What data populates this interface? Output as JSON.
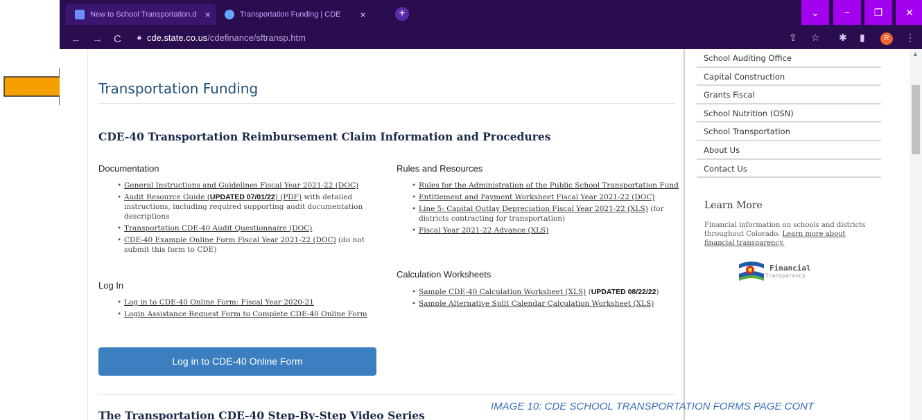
{
  "browser": {
    "tabs": [
      {
        "label": "New to School Transportation.d",
        "close": "×"
      },
      {
        "label": "Transportation Funding | CDE",
        "close": "×"
      }
    ],
    "new_tab": "+",
    "url_domain": "cde.state.co.us",
    "url_path": "/cdefinance/sftransp.htm",
    "profile_initial": "R",
    "window_controls": {
      "menu": "⌄",
      "minimize": "−",
      "maximize": "❐",
      "close": "✕"
    },
    "nav": {
      "back": "←",
      "forward": "→",
      "reload": "C"
    }
  },
  "page": {
    "title": "Transportation Funding",
    "section_heading": "CDE-40 Transportation Reimbursement Claim Information and Procedures",
    "documentation": {
      "heading": "Documentation",
      "items": [
        {
          "link": "General Instructions and Guidelines Fiscal Year 2021-22 (DOC)"
        },
        {
          "link": "Audit Resource Guide (",
          "strong": "UPDATED 07/01/22",
          "link2": ") (PDF)",
          "rest": " with detailed instructions, including required supporting audit documentation descriptions"
        },
        {
          "link": "Transportation CDE-40 Audit Questionnaire (DOC)"
        },
        {
          "link": "CDE-40 Example Online Form Fiscal Year 2021-22 (DOC)",
          "rest": " (do not submit this form to CDE)"
        }
      ]
    },
    "login": {
      "heading": "Log In",
      "items": [
        {
          "link": "Log in to CDE-40 Online Form: Fiscal Year 2020-21"
        },
        {
          "link": "Login Assistance Request Form to Complete CDE-40 Online Form"
        }
      ],
      "button_label": "Log in to CDE-40 Online Form"
    },
    "rules": {
      "heading": "Rules and Resources",
      "items": [
        {
          "link": "Rules for the Administration of the Public School Transportation Fund"
        },
        {
          "link": "Entitlement and Payment Worksheet Fiscal Year 2021-22 (DOC)"
        },
        {
          "link": "Line 5: Capital Outlay Depreciation Fiscal Year 2021-22 (XLS)",
          "rest": " (for districts contracting for transportation)"
        },
        {
          "link": "Fiscal Year 2021-22 Advance (XLS)"
        }
      ]
    },
    "calculation": {
      "heading": "Calculation Worksheets",
      "items": [
        {
          "link": "Sample CDE-40 Calculation Worksheet (XLS)",
          "strong_prefix": " (",
          "strong": "UPDATED 08/22/22",
          "link2": ")"
        },
        {
          "link": "Sample Alternative Split Calendar Calculation Worksheet (XLS)"
        }
      ]
    },
    "video_heading": "The Transportation CDE-40 Step-By-Step Video Series"
  },
  "sidebar": {
    "items": [
      "School Auditing Office",
      "Capital Construction",
      "Grants Fiscal",
      "School Nutrition (OSN)",
      "School Transportation",
      "About Us",
      "Contact Us"
    ],
    "learn_more": {
      "title": "Learn More",
      "text": "Financial information on schools and districts throughout Colorado. ",
      "link": "Learn more about financial transparency."
    },
    "logo": {
      "name": "Financial",
      "sub": "Transparency"
    }
  },
  "caption": "IMAGE 10: CDE SCHOOL TRANSPORTATION FORMS PAGE CONT",
  "colors": {
    "tab_bar": "#2a0d4f",
    "accent": "#a400f0",
    "button": "#3b7fc0",
    "arrow": "#f5a000"
  }
}
